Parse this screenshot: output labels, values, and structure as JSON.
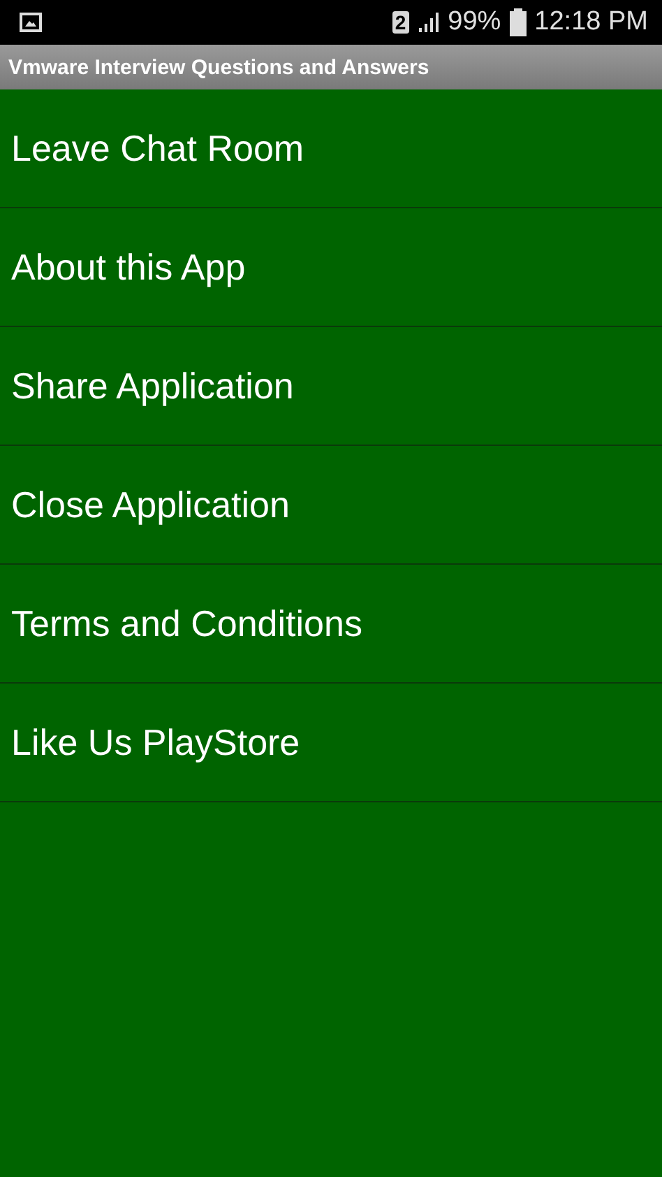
{
  "status_bar": {
    "sim": "2",
    "battery": "99%",
    "time": "12:18 PM"
  },
  "window": {
    "title": "Vmware Interview Questions and Answers"
  },
  "menu": {
    "items": [
      {
        "label": "Leave Chat Room"
      },
      {
        "label": "About this App"
      },
      {
        "label": "Share Application"
      },
      {
        "label": "Close Application"
      },
      {
        "label": "Terms and Conditions"
      },
      {
        "label": "Like Us PlayStore"
      }
    ]
  }
}
